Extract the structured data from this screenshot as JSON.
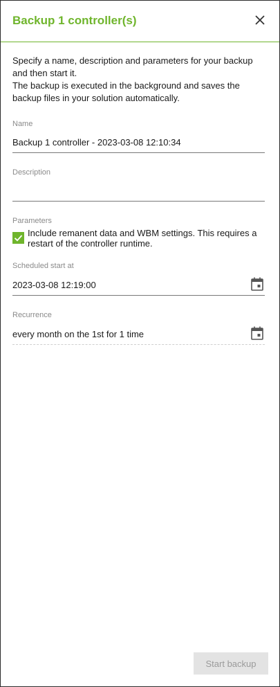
{
  "dialog": {
    "title": "Backup 1 controller(s)",
    "close_icon": "close-icon",
    "intro_line1": "Specify a name, description and parameters for your backup and then start it.",
    "intro_line2": "The backup is executed in the background and saves the backup files in your solution automatically."
  },
  "name_field": {
    "label": "Name",
    "value": "Backup 1 controller - 2023-03-08 12:10:34"
  },
  "description_field": {
    "label": "Description",
    "value": ""
  },
  "parameters": {
    "label": "Parameters",
    "checkbox_checked": true,
    "checkbox_label": "Include remanent data and WBM settings. This requires a restart of the controller runtime."
  },
  "scheduled_start": {
    "label": "Scheduled start at",
    "value": "2023-03-08 12:19:00",
    "icon": "calendar-icon"
  },
  "recurrence": {
    "label": "Recurrence",
    "value": "every month on the 1st for 1 time",
    "icon": "calendar-icon"
  },
  "footer": {
    "start_button_label": "Start backup",
    "start_button_enabled": false
  },
  "colors": {
    "accent": "#6fb52c",
    "disabled_button_bg": "#e3e3e3",
    "disabled_button_text": "#9a9a9a"
  }
}
